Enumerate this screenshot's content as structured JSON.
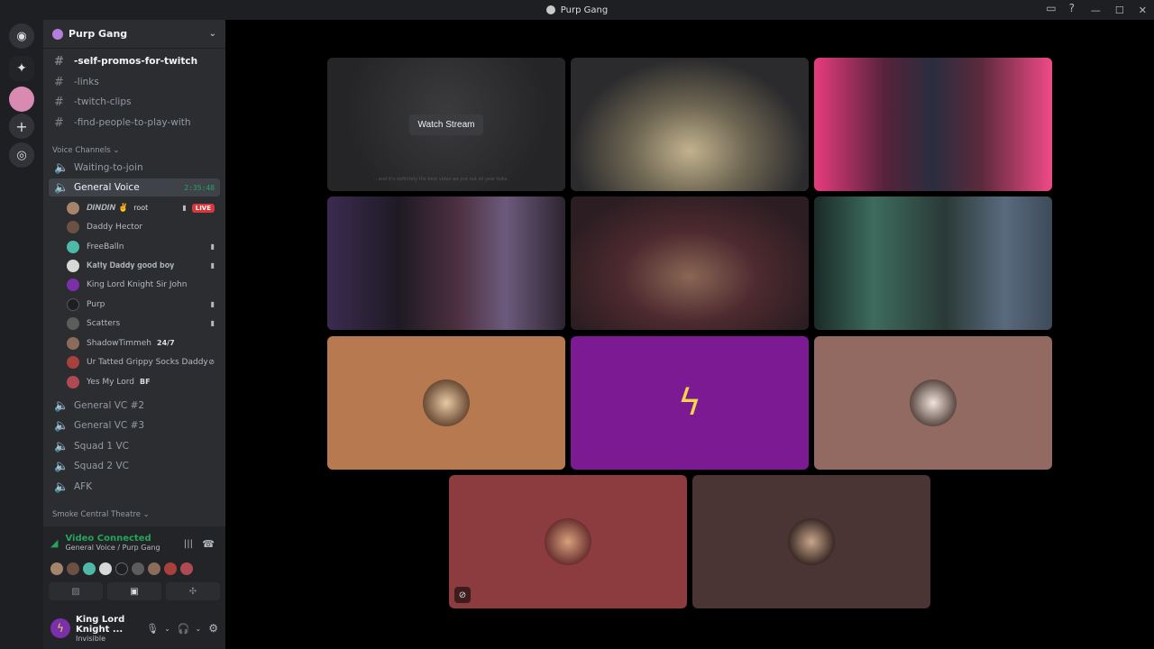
{
  "window": {
    "title": "Purp Gang"
  },
  "server": {
    "name": "Purp Gang"
  },
  "text_channels": [
    {
      "name": "-self-promos-for-twitch"
    },
    {
      "name": "-links"
    },
    {
      "name": "-twitch-clips"
    },
    {
      "name": "-find-people-to-play-with"
    }
  ],
  "voice_category": "Voice Channels",
  "voice_channels": [
    {
      "name": "Waiting-to-join"
    },
    {
      "name": "General Voice",
      "timer": "2:35:48"
    },
    {
      "name": "General VC #2"
    },
    {
      "name": "General VC #3"
    },
    {
      "name": "Squad 1 VC"
    },
    {
      "name": "Squad 2 VC"
    },
    {
      "name": "AFK"
    }
  ],
  "members": [
    {
      "name": "𝑫𝑰𝑵𝑫𝑰𝑵 ✌️",
      "tag": "root",
      "live": "LIVE"
    },
    {
      "name": "Daddy Hector"
    },
    {
      "name": "FreeBalln"
    },
    {
      "name": "𝐊𝐚𝐭𝐭𝐲 𝐃𝐚𝐝𝐝𝐲 𝐠𝐨𝐨𝐝 𝐛𝐨𝐲"
    },
    {
      "name": "King Lord Knight Sir John"
    },
    {
      "name": "Purp"
    },
    {
      "name": "Scatters"
    },
    {
      "name": "ShadowTimmeh",
      "tag": "24/7"
    },
    {
      "name": "Ur Tatted Grippy Socks Daddy"
    },
    {
      "name": "Yes My Lord",
      "tag": "BF"
    }
  ],
  "theatre_category": "Smoke Central Theatre",
  "voice_panel": {
    "status": "Video Connected",
    "location": "General Voice / Purp Gang"
  },
  "user": {
    "name": "King Lord Knight ...",
    "status": "Invisible"
  },
  "stage": {
    "watch_stream": "Watch Stream",
    "stream_caption": "...and it's definitely the best video we put out all year folks."
  },
  "colors": {
    "accent": "#5865f2",
    "green": "#23a55a",
    "live": "#da373c"
  }
}
